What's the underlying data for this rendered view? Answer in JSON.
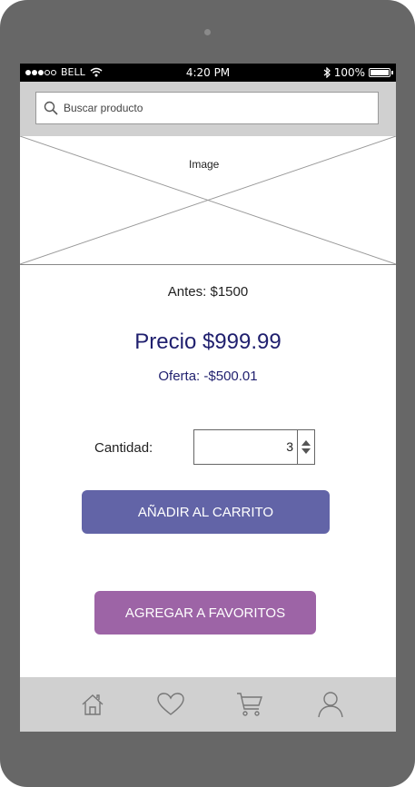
{
  "status_bar": {
    "carrier": "BELL",
    "time": "4:20 PM",
    "battery": "100%"
  },
  "search": {
    "placeholder": "Buscar producto"
  },
  "image": {
    "label": "Image"
  },
  "product": {
    "antes": "Antes: $1500",
    "precio": "Precio $999.99",
    "oferta": "Oferta: -$500.01"
  },
  "quantity": {
    "label": "Cantidad:",
    "value": "3"
  },
  "buttons": {
    "add_to_cart": "AÑADIR AL CARRITO",
    "add_to_favorites": "AGREGAR A FAVORITOS"
  },
  "bottom_nav": {
    "items": [
      {
        "icon": "home-icon"
      },
      {
        "icon": "heart-icon"
      },
      {
        "icon": "cart-icon"
      },
      {
        "icon": "user-icon"
      }
    ]
  },
  "colors": {
    "price_text": "#1f1f6e",
    "cart_button": "#6264a7",
    "favorites_button": "#9d64a6",
    "bars": "#d0d0d0",
    "phone_frame": "#676767"
  }
}
